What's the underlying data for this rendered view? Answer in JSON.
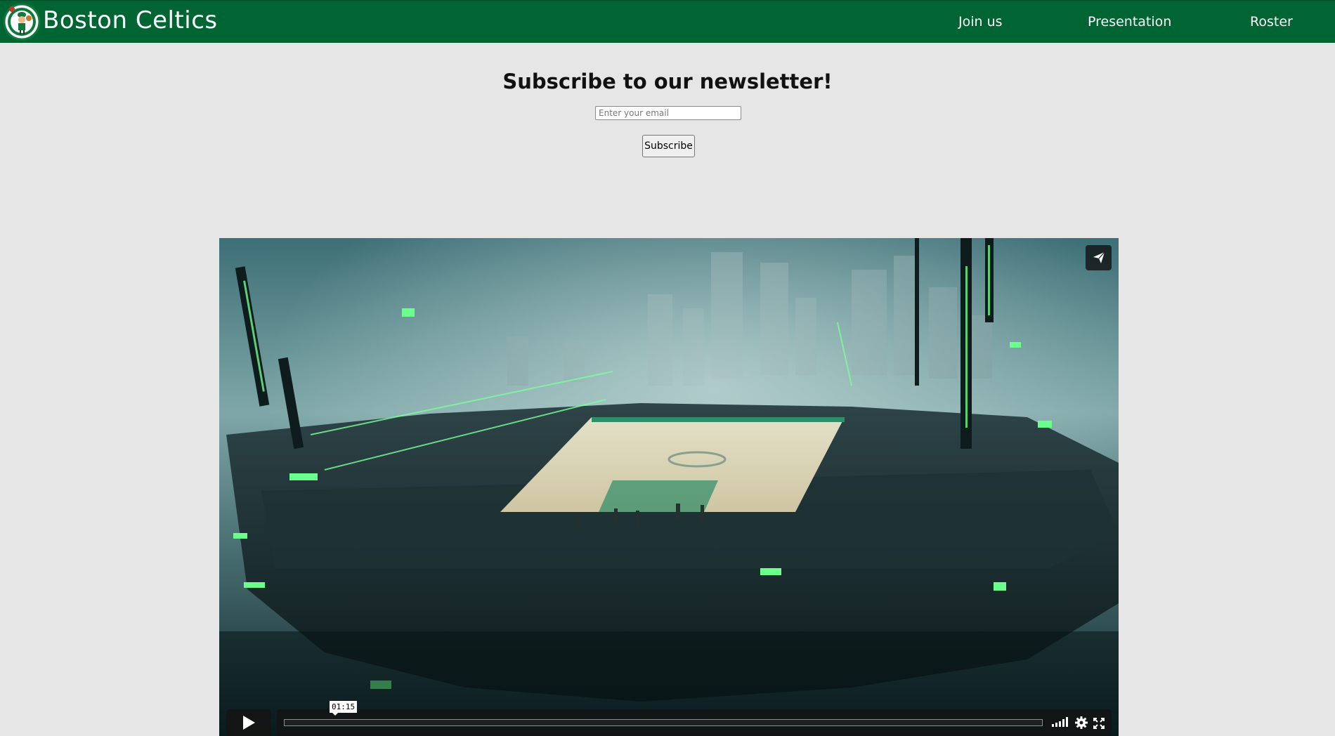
{
  "header": {
    "brand": "Boston Celtics",
    "logo_icon": "celtics-leprechaun-logo",
    "nav": [
      {
        "label": "Join us"
      },
      {
        "label": "Presentation"
      },
      {
        "label": "Roster"
      }
    ],
    "background_color": "#006532"
  },
  "newsletter": {
    "title": "Subscribe to our newsletter!",
    "email_placeholder": "Enter your email",
    "email_value": "",
    "button_label": "Subscribe"
  },
  "video": {
    "current_time": "01:15",
    "progress": 0.0,
    "share_icon": "paper-plane-icon",
    "play_icon": "play-icon",
    "volume_icon": "volume-bars-icon",
    "settings_icon": "gear-icon",
    "fullscreen_icon": "fullscreen-icon"
  }
}
